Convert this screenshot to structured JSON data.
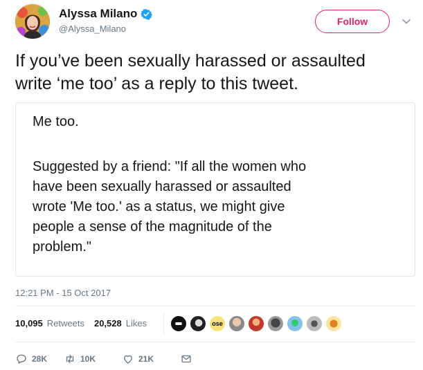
{
  "author": {
    "name": "Alyssa Milano",
    "handle": "@Alyssa_Milano",
    "verified": true,
    "avatar_icon": "profile-photo"
  },
  "follow_button": {
    "label": "Follow",
    "color": "#e0245e"
  },
  "more_icon": "chevron-down-icon",
  "tweet": {
    "text": "If you’ve been sexually harassed or assaulted\nwrite ‘me too’ as a reply to this tweet."
  },
  "quoted_card": {
    "line1": "Me too.",
    "paragraph": "Suggested by a friend: \"If all the women who\nhave been sexually harassed or assaulted\nwrote 'Me too.' as a status, we might give\npeople a sense of the magnitude of the\nproblem.\""
  },
  "timestamp": "12:21 PM - 15 Oct 2017",
  "stats": {
    "retweets_count": "10,095",
    "retweets_label": "Retweets",
    "likes_count": "20,528",
    "likes_label": "Likes"
  },
  "liker_badge_text": "ose",
  "actions": {
    "reply_count": "28K",
    "retweet_count": "10K",
    "like_count": "21K"
  },
  "colors": {
    "text": "#14171a",
    "secondary": "#657786",
    "verified": "#1da1f2",
    "border": "#e1e8ed"
  }
}
